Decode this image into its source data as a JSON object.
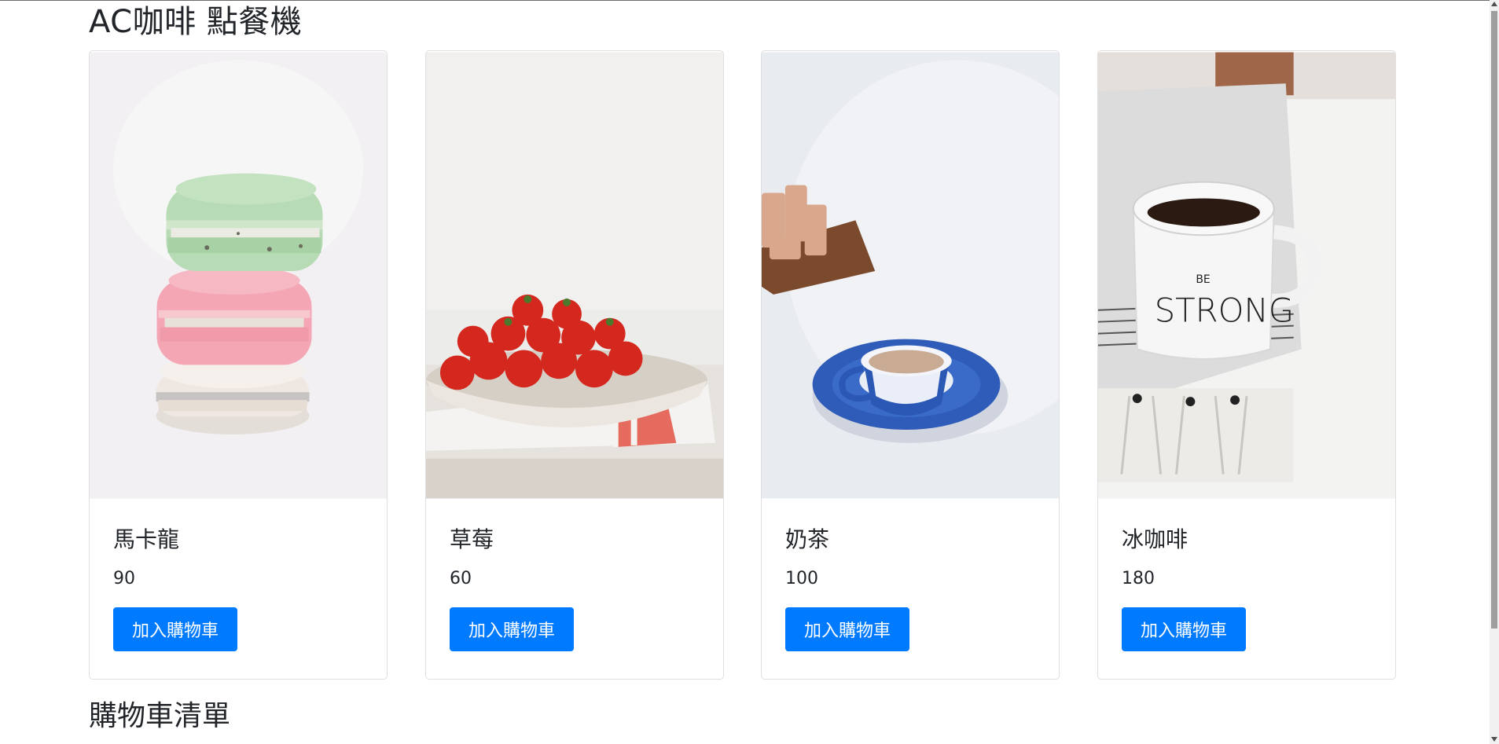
{
  "header": {
    "title": "AC咖啡 點餐機"
  },
  "products": [
    {
      "name": "馬卡龍",
      "price": "90",
      "button_label": "加入購物車"
    },
    {
      "name": "草莓",
      "price": "60",
      "button_label": "加入購物車"
    },
    {
      "name": "奶茶",
      "price": "100",
      "button_label": "加入購物車"
    },
    {
      "name": "冰咖啡",
      "price": "180",
      "button_label": "加入購物車"
    }
  ],
  "cart": {
    "title": "購物車清單"
  },
  "colors": {
    "primary": "#007bff",
    "card_border": "#dfdfdf",
    "text": "#212529"
  }
}
